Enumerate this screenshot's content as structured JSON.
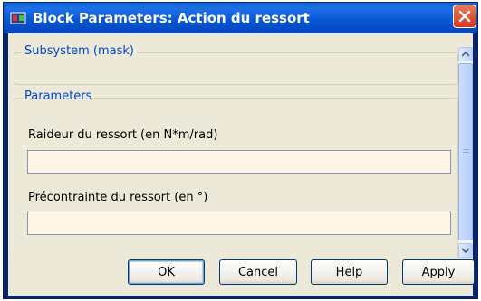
{
  "window": {
    "title": "Block Parameters: Action du ressort",
    "icon": "simulink-block-icon",
    "close_icon": "close-icon"
  },
  "subsystem_group": {
    "legend": "Subsystem (mask)"
  },
  "parameters_group": {
    "legend": "Parameters",
    "fields": [
      {
        "label": "Raideur du ressort (en N*m/rad)",
        "value": ""
      },
      {
        "label": "Précontrainte du ressort (en °)",
        "value": ""
      }
    ]
  },
  "buttons": {
    "ok": "OK",
    "cancel": "Cancel",
    "help": "Help",
    "apply": "Apply"
  },
  "colors": {
    "title_bar": "#0555d5",
    "legend_text": "#0046d5",
    "field_background": "#fff5e6",
    "dialog_background": "#ece9d8"
  }
}
